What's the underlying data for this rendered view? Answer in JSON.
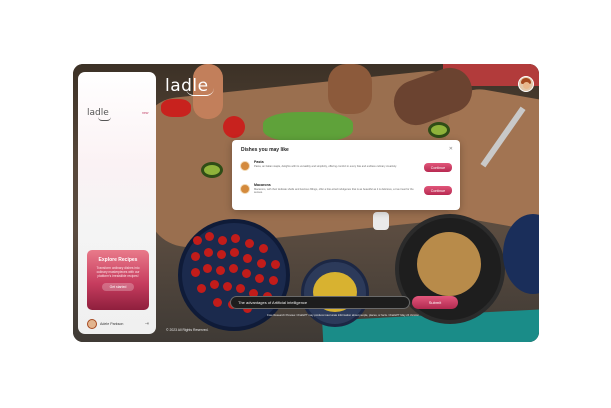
{
  "brand": {
    "name": "ladle"
  },
  "sidebar": {
    "logo": "ladle",
    "new_label": "new",
    "promo": {
      "title": "Explore Recipes",
      "text": "Transform ordinary dishes into culinary masterpieces with our platform's irresistible recipes!",
      "button": "Get started"
    },
    "user": {
      "name": "Adele Parkson"
    }
  },
  "dialog": {
    "title": "Dishes you may like",
    "dishes": [
      {
        "name": "Pasta",
        "description": "Pasta, an Italian staple, delights with its versatility and simplicity, offering comfort in every bite and endless culinary creativity.",
        "button": "Continue"
      },
      {
        "name": "Macarons",
        "description": "Macarons, with their delicate shells and luscious fillings, offer a bite-sized indulgence that is as beautiful as it is delicious, a true treat for the senses.",
        "button": "Continue"
      }
    ]
  },
  "prompt": {
    "value": "The advantages of Artificial intelligence",
    "submit": "Submit",
    "disclaimer": "Free Research Preview. ChatGPT may produce inaccurate information about people, places, or facts. ChatGPT May 24 Version"
  },
  "footer": {
    "copyright": "© 2023 All Rights Reserved."
  },
  "colors": {
    "accent": "#c73d5f",
    "sidebar_bg": "#f4f4f4",
    "dialog_bg": "#ffffff"
  },
  "icons": {
    "close": "close-icon",
    "logout": "logout-icon"
  }
}
